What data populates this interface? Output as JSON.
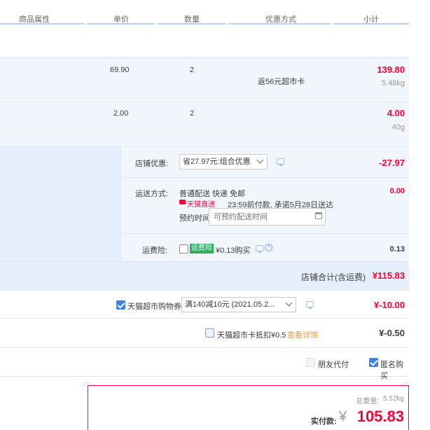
{
  "header": {
    "columns": [
      "商品属性",
      "单价",
      "数量",
      "优惠方式",
      "小计"
    ]
  },
  "items": [
    {
      "price": "69.90",
      "qty": "2",
      "promo": "返56元超市卡",
      "subtotal": "139.80",
      "weight": "5.48kg"
    },
    {
      "price": "2.00",
      "qty": "2",
      "promo": "",
      "subtotal": "4.00",
      "weight": "40g"
    }
  ],
  "shop": {
    "discount_label": "店铺优惠:",
    "discount_select": "省27.97元:组合优惠",
    "discount_value": "-27.97",
    "shipping_label": "运送方式:",
    "shipping_method": "普通配送 快递 免邮",
    "shipping_badge": "天猫直送",
    "shipping_note": "23:59前付款, 承诺5月28日送达",
    "appointment_label": "预约时间",
    "appointment_placeholder": "可预约配送时间",
    "shipping_value": "0.00",
    "insurance_label": "运费险:",
    "insurance_tag": "运费险",
    "insurance_price": "¥0.13购买",
    "insurance_value": "0.13",
    "total_label": "店铺合计(含运费)",
    "total_value": "¥115.83"
  },
  "coupon": {
    "label": "天猫超市购物券",
    "select": "满140减10元 (2021.05.2...",
    "value": "¥-10.00"
  },
  "card": {
    "label": "天猫超市卡抵扣¥0.5",
    "link": "查看详情",
    "value": "¥-0.50"
  },
  "options": {
    "friend_pay": "朋友代付",
    "anonymous": "匿名购买"
  },
  "summary": {
    "weight_label": "总重量:",
    "weight_value": "5.52kg",
    "pay_label": "实付款:",
    "currency": "¥",
    "pay_value": "105.83"
  },
  "colors": {
    "accent_red": "#ff0036",
    "accent_blue": "#3d82e0",
    "band_bg": "#f1f6fd"
  }
}
